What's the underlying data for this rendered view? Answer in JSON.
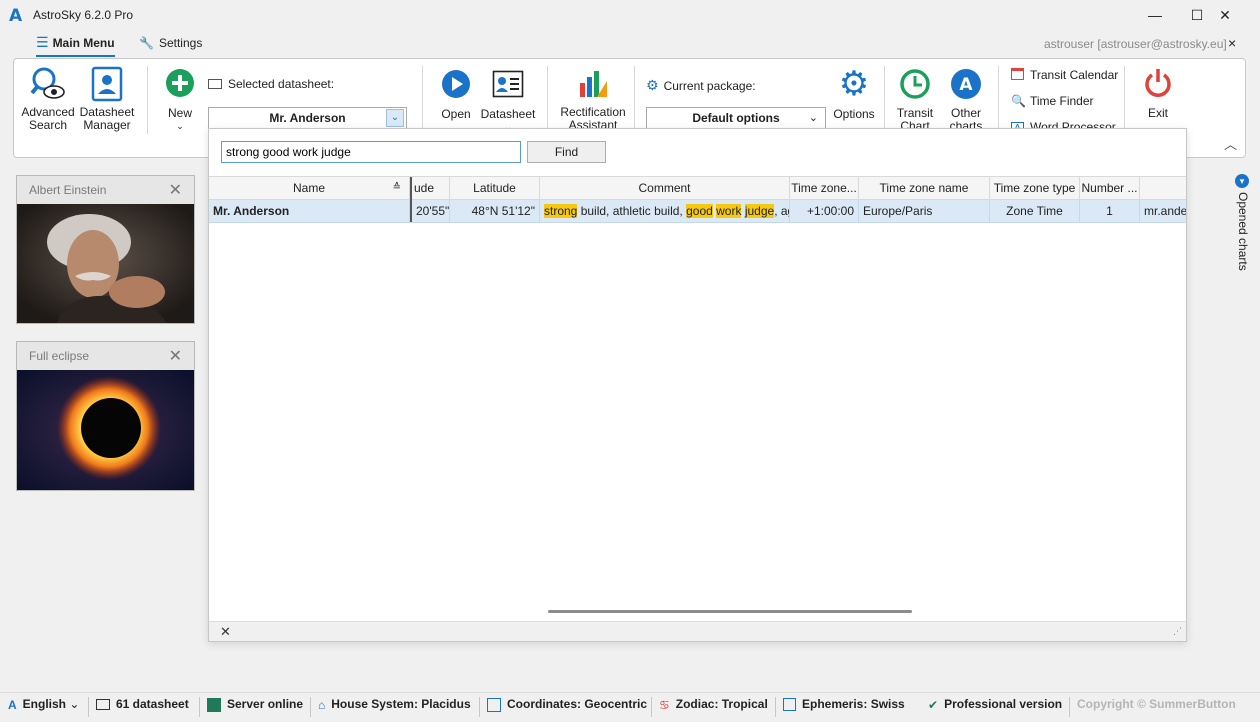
{
  "window": {
    "logo": "A",
    "title": "AstroSky 6.2.0 Pro",
    "minimize": "—",
    "maximize": "☐",
    "close": "✕"
  },
  "menu": {
    "main_label": "Main Menu",
    "settings_label": "Settings",
    "user": "astrouser [astrouser@astrosky.eu]",
    "close": "×"
  },
  "ribbon": {
    "advanced_search": "Advanced Search",
    "datasheet_manager": "Datasheet Manager",
    "new": "New",
    "selected_datasheet_label": "Selected datasheet:",
    "selected_datasheet_value": "Mr. Anderson",
    "open": "Open",
    "datasheet": "Datasheet",
    "rectification": "Rectification Assistant",
    "current_package_label": "Current package:",
    "current_package_value": "Default options",
    "options": "Options",
    "transit_chart": "Transit Chart",
    "other_charts": "Other charts",
    "transit_calendar": "Transit Calendar",
    "time_finder": "Time Finder",
    "word_processor": "Word Processor",
    "exit": "Exit"
  },
  "cards": [
    {
      "title": "Albert Einstein",
      "close": "✕"
    },
    {
      "title": "Full eclipse",
      "close": "✕"
    }
  ],
  "search": {
    "query": "strong good work judge",
    "find_label": "Find"
  },
  "grid": {
    "columns": [
      "Name",
      "ude",
      "Latitude",
      "Comment",
      "Time zone...",
      "Time zone name",
      "Time zone type",
      "Number ...",
      ""
    ],
    "row": {
      "name": "Mr. Anderson",
      "longitude": "20'55\"",
      "latitude": "48°N 51'12\"",
      "comment_parts": [
        "strong",
        " build, athletic build, ",
        "good",
        " ",
        "work",
        " ",
        "judge",
        ", ag..."
      ],
      "tz_offset": "+1:00:00",
      "tz_name": "Europe/Paris",
      "tz_type": "Zone Time",
      "number": "1",
      "extra": "mr.ander"
    },
    "footer_close": "✕"
  },
  "side": {
    "opened_charts": "Opened charts"
  },
  "status": {
    "language": "English",
    "datasheets": "61 datasheet",
    "server": "Server online",
    "house_system": "House System: Placidus",
    "coordinates": "Coordinates: Geocentric",
    "zodiac": "Zodiac: Tropical",
    "ephemeris": "Ephemeris: Swiss",
    "version": "Professional version",
    "copyright": "Copyright © SummerButton"
  },
  "colors": {
    "accent": "#1a73c8",
    "new_green": "#1aa05a",
    "exit_red": "#e0413a",
    "highlight": "#f6c90e",
    "row_selected": "#dbe9f6"
  }
}
